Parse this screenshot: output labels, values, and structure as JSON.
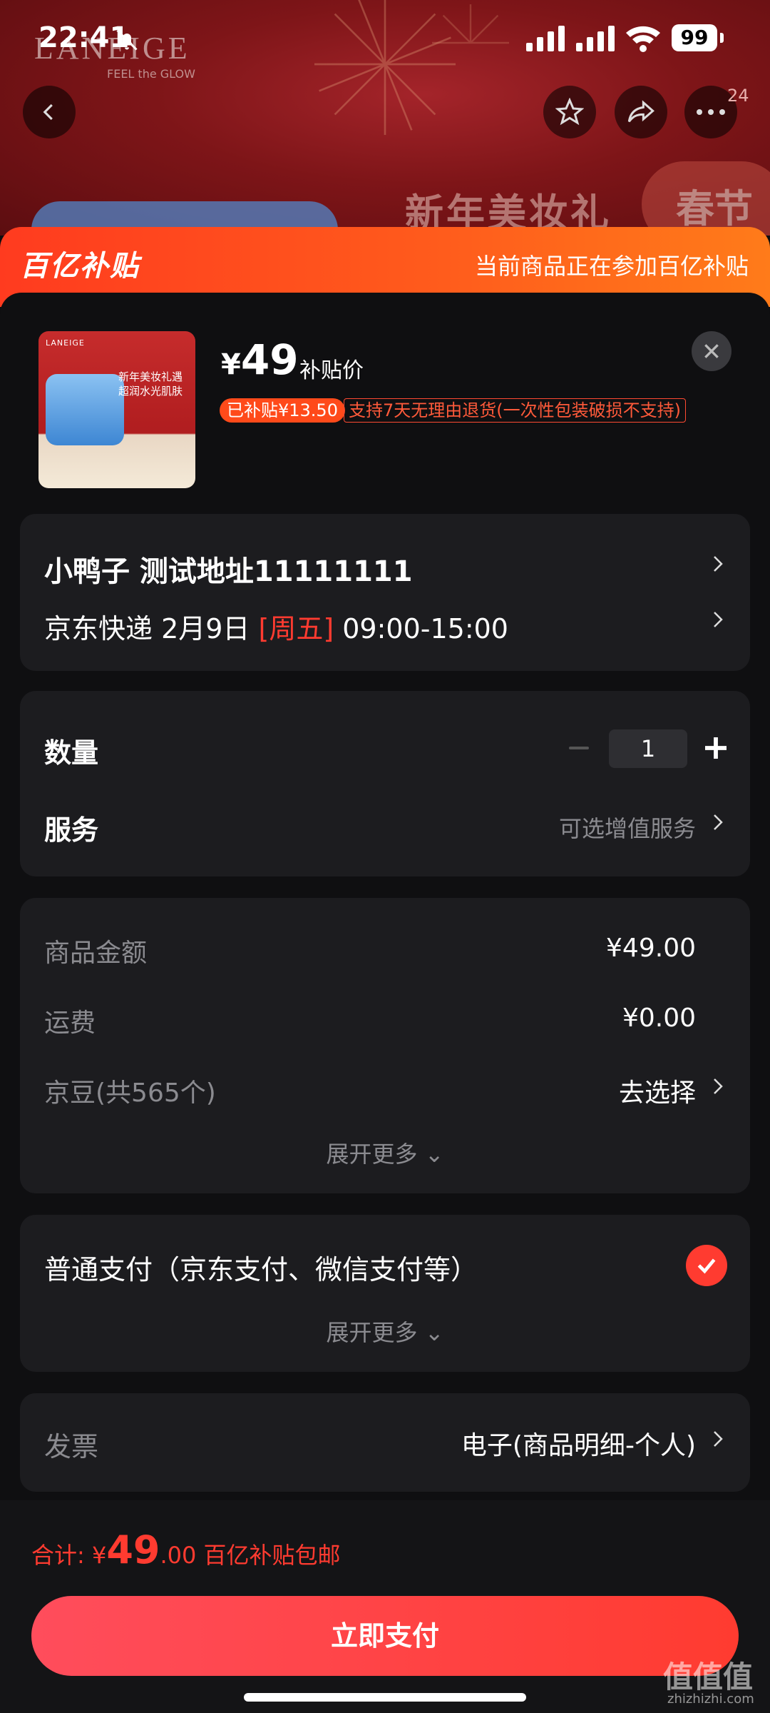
{
  "status_bar": {
    "time": "22:41",
    "battery": "99"
  },
  "background_page": {
    "brand": "LANEIGE",
    "brand_tagline": "FEEL the GLOW",
    "banner_text": "新年美妆礼",
    "banner_tag": "春节",
    "notification_count": "24"
  },
  "sheet_header": {
    "logo": "百亿补贴",
    "note": "当前商品正在参加百亿补贴"
  },
  "product": {
    "image_brand": "LANEIGE",
    "image_text": "新年美妆礼遇 超润水光肌肤",
    "currency": "¥",
    "price": "49",
    "price_label": "补贴价",
    "subsidy_tag": "已补贴¥13.50",
    "return_policy": "支持7天无理由退货(一次性包装破损不支持)"
  },
  "address": {
    "recipient": "小鸭子  测试地址11111111",
    "carrier_date": "京东快递 2月9日 ",
    "weekday": "[周五]",
    "time_window": " 09:00-15:00"
  },
  "options": {
    "quantity_label": "数量",
    "quantity_value": "1",
    "service_label": "服务",
    "service_value": "可选增值服务"
  },
  "amounts": {
    "goods_label": "商品金额",
    "goods_value": "¥49.00",
    "shipping_label": "运费",
    "shipping_value": "¥0.00",
    "jingdou_label": "京豆(共565个)",
    "jingdou_value": "去选择",
    "expand": "展开更多"
  },
  "payment": {
    "method": "普通支付（京东支付、微信支付等）",
    "expand": "展开更多"
  },
  "invoice": {
    "label": "发票",
    "value": "电子(商品明细-个人)"
  },
  "bottom": {
    "total_prefix": "合计: ¥",
    "total_int": "49",
    "total_dec": ".00",
    "total_note": " 百亿补贴包邮",
    "pay_button": "立即支付"
  },
  "watermark": {
    "main": "值值值",
    "sub": "zhizhizhi.com"
  },
  "colors": {
    "accent": "#ff3b30",
    "header_orange": "#ff5a1c",
    "card_bg": "#1c1c1f",
    "sheet_bg": "#0f0f11"
  },
  "icons": [
    "back-icon",
    "star-icon",
    "share-icon",
    "more-icon",
    "close-icon",
    "chevron-right-icon",
    "minus-icon",
    "plus-icon",
    "check-icon",
    "chevron-down-icon"
  ]
}
